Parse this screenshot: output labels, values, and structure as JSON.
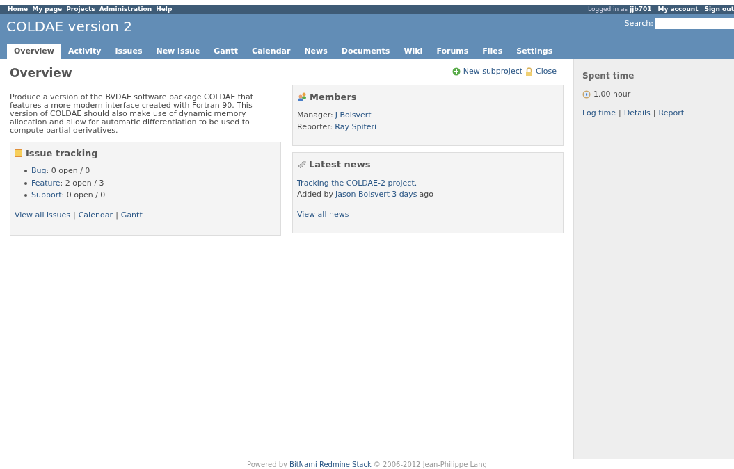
{
  "top_menu": {
    "items": [
      "Home",
      "My page",
      "Projects",
      "Administration",
      "Help"
    ],
    "logged_in_prefix": "Logged in as",
    "user": "jjb701",
    "account_items": [
      "My account",
      "Sign out"
    ]
  },
  "header": {
    "title": "COLDAE version 2",
    "search_label": "Search:"
  },
  "tabs": [
    {
      "label": "Overview",
      "selected": true
    },
    {
      "label": "Activity",
      "selected": false
    },
    {
      "label": "Issues",
      "selected": false
    },
    {
      "label": "New issue",
      "selected": false
    },
    {
      "label": "Gantt",
      "selected": false
    },
    {
      "label": "Calendar",
      "selected": false
    },
    {
      "label": "News",
      "selected": false
    },
    {
      "label": "Documents",
      "selected": false
    },
    {
      "label": "Wiki",
      "selected": false
    },
    {
      "label": "Forums",
      "selected": false
    },
    {
      "label": "Files",
      "selected": false
    },
    {
      "label": "Settings",
      "selected": false
    }
  ],
  "content": {
    "title": "Overview",
    "actions": [
      {
        "kind": "add",
        "label": "New subproject"
      },
      {
        "kind": "lock",
        "label": "Close"
      }
    ],
    "description": "Produce a version of the BVDAE software package COLDAE that features a more modern interface created with Fortran 90. This version of COLDAE should also make use of dynamic memory allocation and allow for automatic differentiation to be used to compute partial derivatives.",
    "issue_tracking": {
      "title": "Issue tracking",
      "trackers": [
        {
          "name": "Bug",
          "counts": ": 0 open / 0"
        },
        {
          "name": "Feature",
          "counts": ": 2 open / 3"
        },
        {
          "name": "Support",
          "counts": ": 0 open / 0"
        }
      ],
      "links": [
        "View all issues",
        "Calendar",
        "Gantt"
      ]
    },
    "members": {
      "title": "Members",
      "rows": [
        {
          "role": "Manager:",
          "name": "J Boisvert"
        },
        {
          "role": "Reporter:",
          "name": "Ray Spiteri"
        }
      ]
    },
    "news": {
      "title": "Latest news",
      "items": [
        {
          "title": "Tracking the COLDAE-2 project.",
          "added_by": "Added by",
          "author": "Jason Boisvert",
          "age": "3 days",
          "suffix": "ago"
        }
      ],
      "view_all": "View all news"
    }
  },
  "sidebar": {
    "title": "Spent time",
    "hours": "1.00 hour",
    "links": [
      "Log time",
      "Details",
      "Report"
    ]
  },
  "separator": "|",
  "footer": {
    "prefix": "Powered by",
    "link": "BitNami Redmine Stack",
    "suffix": "© 2006-2012 Jean-Philippe Lang"
  }
}
